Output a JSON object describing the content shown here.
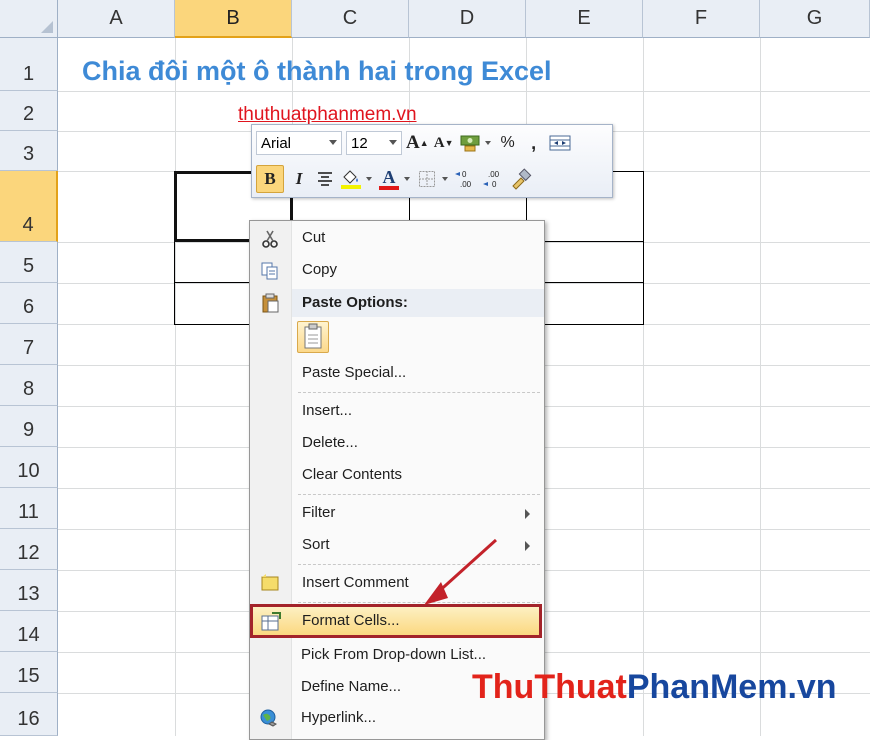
{
  "columns": [
    "A",
    "B",
    "C",
    "D",
    "E",
    "F",
    "G"
  ],
  "selected_column": "B",
  "rows": [
    "1",
    "2",
    "3",
    "4",
    "5",
    "6",
    "7",
    "8",
    "9",
    "10",
    "11",
    "12",
    "13",
    "14",
    "15",
    "16"
  ],
  "selected_row": "4",
  "cells": {
    "A1": "Chia đôi một ô thành hai trong Excel",
    "B2": "thuthuatphanmem.vn"
  },
  "mini_toolbar": {
    "font_name": "Arial",
    "font_size": "12",
    "grow_font": "A",
    "shrink_font": "A",
    "percent": "%",
    "comma": ",",
    "bold": "B",
    "italic": "I",
    "font_color": "A"
  },
  "context_menu": {
    "cut": "Cut",
    "copy": "Copy",
    "paste_options": "Paste Options:",
    "paste_special": "Paste Special...",
    "insert": "Insert...",
    "delete": "Delete...",
    "clear_contents": "Clear Contents",
    "filter": "Filter",
    "sort": "Sort",
    "insert_comment": "Insert Comment",
    "format_cells": "Format Cells...",
    "pick_from_list": "Pick From Drop-down List...",
    "define_name": "Define Name...",
    "hyperlink": "Hyperlink..."
  },
  "highlighted_item": "Format Cells...",
  "watermark": {
    "part1": "Thu",
    "part2": "Thuat",
    "part3": "PhanMem",
    "part4": ".vn"
  },
  "colors": {
    "title": "#3e8ad6",
    "link": "#e0141e",
    "highlight_border": "#a3232a",
    "arrow": "#c3222a",
    "selected_header": "#fbd67c"
  }
}
